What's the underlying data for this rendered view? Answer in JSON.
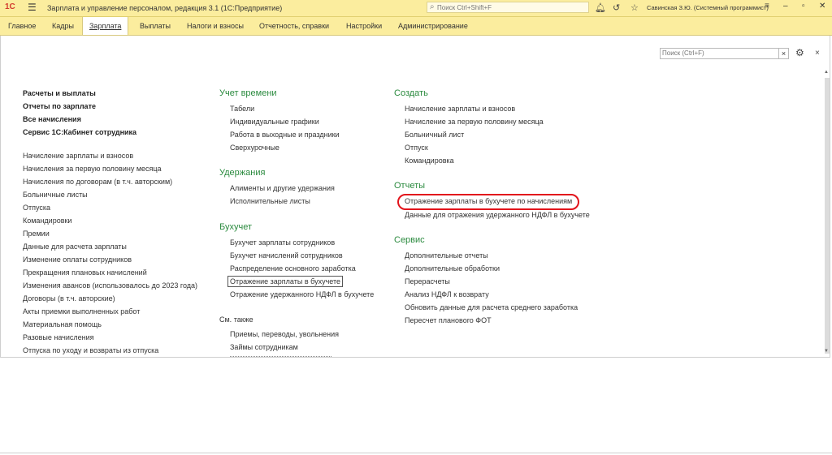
{
  "titlebar": {
    "logo": "1С",
    "title": "Зарплата и управление персоналом, редакция 3.1  (1С:Предприятие)",
    "search_placeholder": "Поиск Ctrl+Shift+F",
    "user": "Савинская З.Ю. (Системный программист)",
    "icons": [
      "bell-icon",
      "history-icon",
      "star-icon",
      "menu-lines-icon",
      "minimize-icon",
      "restore-icon",
      "close-icon"
    ]
  },
  "sections": {
    "items": [
      "Главное",
      "Кадры",
      "Зарплата",
      "Выплаты",
      "Налоги и взносы",
      "Отчетность, справки",
      "Настройки",
      "Администрирование"
    ],
    "active": "Зарплата"
  },
  "panel": {
    "search_placeholder": "Поиск (Ctrl+F)",
    "clear": "×",
    "close": "×"
  },
  "left": {
    "bold_items": [
      "Расчеты и выплаты",
      "Отчеты по зарплате",
      "Все начисления",
      "Сервис 1С:Кабинет сотрудника"
    ],
    "items": [
      "Начисление зарплаты и взносов",
      "Начисления за первую половину месяца",
      "Начисления по договорам (в т.ч. авторским)",
      "Больничные листы",
      "Отпуска",
      "Командировки",
      "Премии",
      "Данные для расчета зарплаты",
      "Изменение оплаты сотрудников",
      "Прекращения плановых начислений",
      "Изменения авансов (использовалось до 2023 года)",
      "Договоры (в т.ч. авторские)",
      "Акты приемки выполненных работ",
      "Материальная помощь",
      "Разовые начисления",
      "Отпуска по уходу и возвраты из отпуска"
    ]
  },
  "middle": {
    "time": {
      "title": "Учет времени",
      "items": [
        "Табели",
        "Индивидуальные графики",
        "Работа в выходные и праздники",
        "Сверхурочные"
      ]
    },
    "deductions": {
      "title": "Удержания",
      "items": [
        "Алименты и другие удержания",
        "Исполнительные листы"
      ]
    },
    "accounting": {
      "title": "Бухучет",
      "items": [
        "Бухучет зарплаты сотрудников",
        "Бухучет начислений сотрудников",
        "Распределение основного заработка",
        "Отражение зарплаты в бухучете",
        "Отражение удержанного НДФЛ в бухучете"
      ]
    },
    "see_also": {
      "title": "См. также",
      "items": [
        "Приемы, переводы, увольнения",
        "Займы сотрудникам"
      ]
    }
  },
  "right": {
    "create": {
      "title": "Создать",
      "items": [
        "Начисление зарплаты и взносов",
        "Начисление за первую половину месяца",
        "Больничный лист",
        "Отпуск",
        "Командировка"
      ]
    },
    "reports": {
      "title": "Отчеты",
      "items": [
        "Отражение зарплаты в бухучете по начислениям",
        "Данные для отражения удержанного НДФЛ в бухучете"
      ]
    },
    "service": {
      "title": "Сервис",
      "items": [
        "Дополнительные отчеты",
        "Дополнительные обработки",
        "Перерасчеты",
        "Анализ НДФЛ к возврату",
        "Обновить данные для расчета среднего заработка",
        "Пересчет планового ФОТ"
      ]
    }
  },
  "colors": {
    "header_bg": "#fbed9e",
    "section_title": "#2a8a3e",
    "highlight": "#e2141c"
  }
}
